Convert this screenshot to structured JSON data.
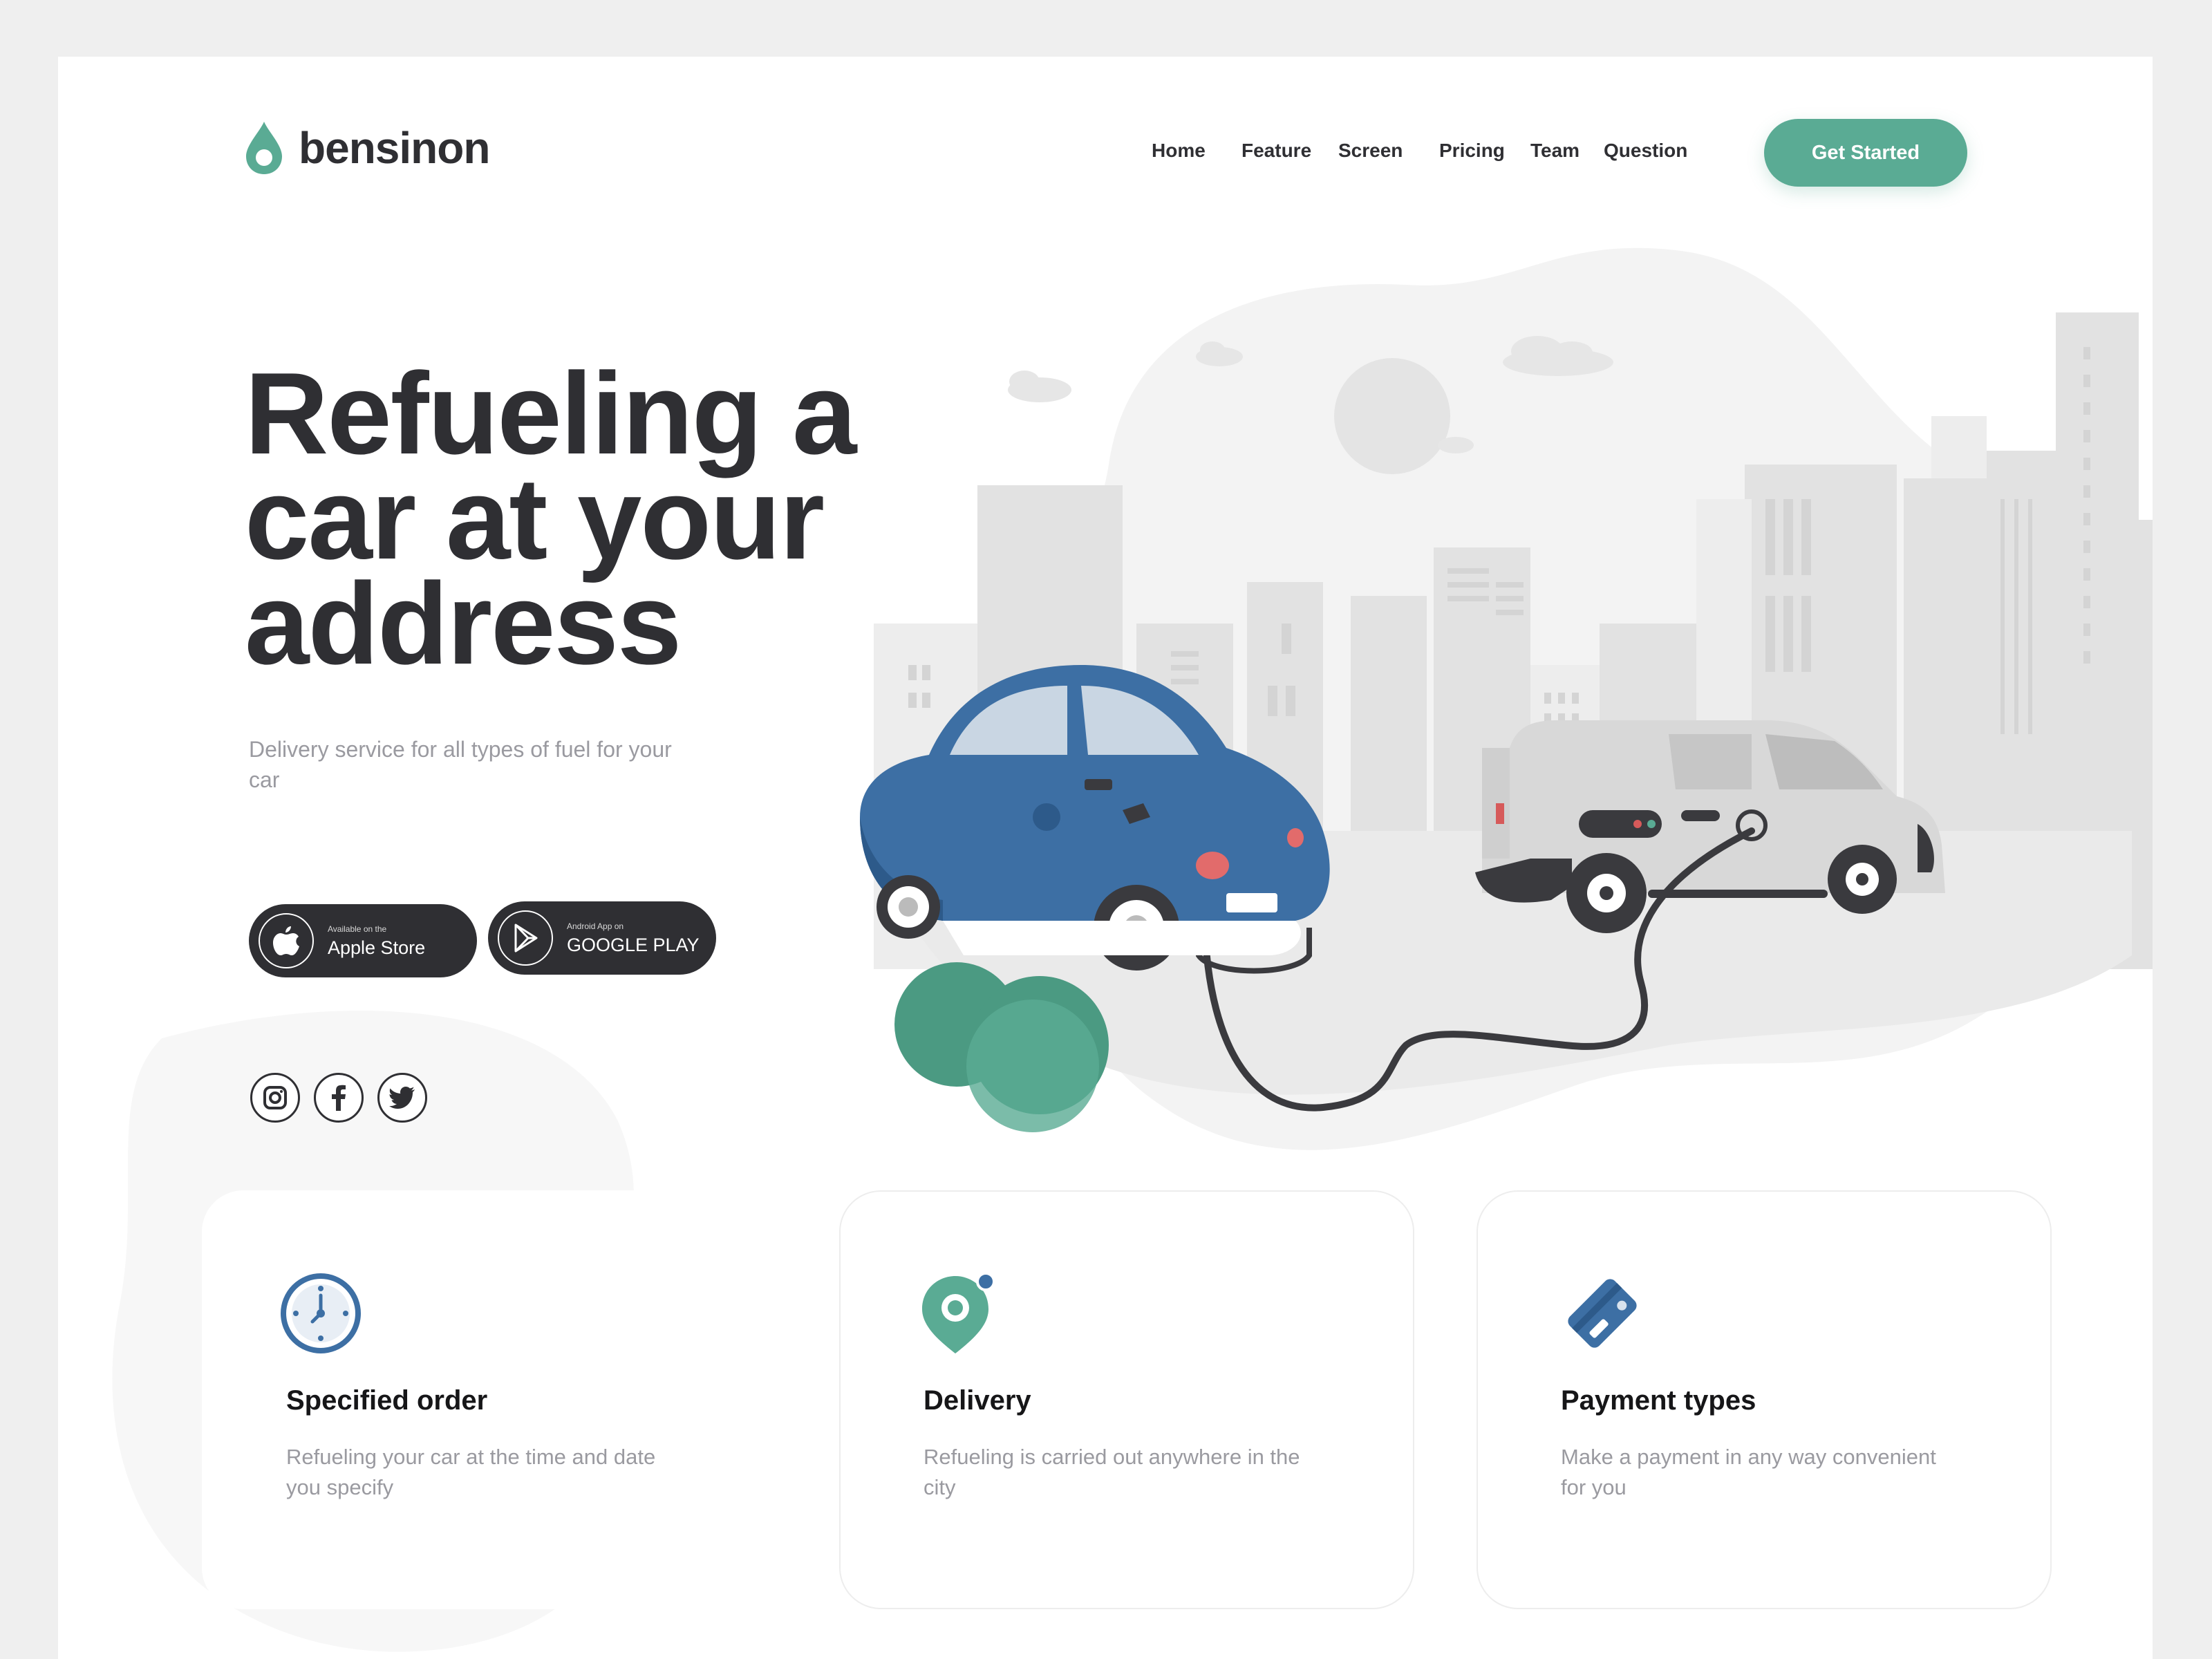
{
  "brand": {
    "name": "bensinon",
    "accent": "#5aab94",
    "dark": "#2f2f33"
  },
  "nav": {
    "items": [
      {
        "label": "Home"
      },
      {
        "label": "Feature"
      },
      {
        "label": "Screen"
      },
      {
        "label": "Pricing"
      },
      {
        "label": "Team"
      },
      {
        "label": "Question"
      }
    ],
    "cta_label": "Get Started"
  },
  "hero": {
    "title_line1": "Refueling a",
    "title_line2": "car at your",
    "title_line3": "address",
    "subtitle": "Delivery service for all types of fuel for your car"
  },
  "stores": {
    "apple": {
      "small": "Available on the",
      "big": "Apple Store",
      "icon": "apple-icon"
    },
    "google": {
      "small": "Android App on",
      "big": "GOOGLE PLAY",
      "icon": "play-icon"
    }
  },
  "social": [
    {
      "icon": "instagram-icon"
    },
    {
      "icon": "facebook-icon"
    },
    {
      "icon": "twitter-icon"
    }
  ],
  "features": [
    {
      "title": "Specified order",
      "desc": "Refueling your car at the time and date you specify",
      "icon": "clock-icon",
      "color": "#3d6fa4"
    },
    {
      "title": "Delivery",
      "desc": "Refueling is carried out anywhere in the city",
      "icon": "location-pin-icon",
      "color": "#5aab94"
    },
    {
      "title": "Payment types",
      "desc": "Make a payment in any way convenient for you",
      "icon": "credit-card-icon",
      "color": "#3d6fa4"
    }
  ]
}
